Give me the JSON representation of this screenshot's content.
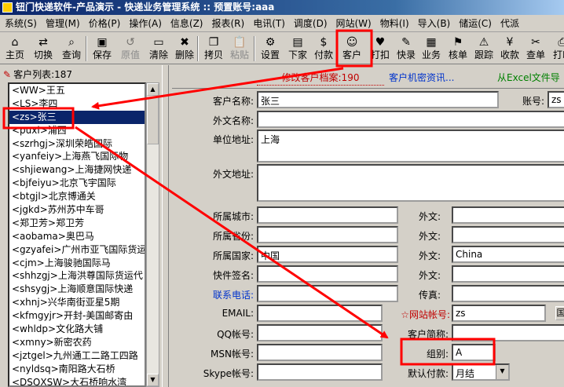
{
  "window": {
    "title": "钮门快递软件-产品演示 - 快递业务管理系统 :: 预置账号:aaa"
  },
  "menu": [
    "系统(S)",
    "管理(M)",
    "价格(P)",
    "操作(A)",
    "信息(Z)",
    "报表(R)",
    "电讯(T)",
    "调度(D)",
    "网站(W)",
    "物料(I)",
    "导入(B)",
    "储运(C)",
    "代派"
  ],
  "toolbar": [
    {
      "label": "主页",
      "icon": "home-icon",
      "glyph": "⌂",
      "disabled": false
    },
    {
      "label": "切换",
      "icon": "switch-icon",
      "glyph": "⇄",
      "disabled": false
    },
    {
      "label": "查询",
      "icon": "query-icon",
      "glyph": "⌕",
      "disabled": false
    },
    {
      "label": "保存",
      "icon": "save-icon",
      "glyph": "▣",
      "disabled": false
    },
    {
      "label": "原值",
      "icon": "original-value-icon",
      "glyph": "↺",
      "disabled": true
    },
    {
      "label": "清除",
      "icon": "clear-icon",
      "glyph": "▭",
      "disabled": false
    },
    {
      "label": "删除",
      "icon": "delete-icon",
      "glyph": "✖",
      "disabled": false
    },
    {
      "label": "拷贝",
      "icon": "copy-icon",
      "glyph": "❐",
      "disabled": false
    },
    {
      "label": "粘贴",
      "icon": "paste-icon",
      "glyph": "📋",
      "disabled": true
    },
    {
      "label": "设置",
      "icon": "settings-icon",
      "glyph": "⚙",
      "disabled": false
    },
    {
      "label": "下家",
      "icon": "next-agent-icon",
      "glyph": "▤",
      "disabled": false
    },
    {
      "label": "付款",
      "icon": "payment-icon",
      "glyph": "$",
      "disabled": false
    },
    {
      "label": "客户",
      "icon": "customer-icon",
      "glyph": "☺",
      "disabled": false
    },
    {
      "label": "打扣",
      "icon": "discount-icon",
      "glyph": "♥",
      "disabled": false
    },
    {
      "label": "快录",
      "icon": "quick-entry-icon",
      "glyph": "✎",
      "disabled": false
    },
    {
      "label": "业务",
      "icon": "business-icon",
      "glyph": "▦",
      "disabled": false
    },
    {
      "label": "核单",
      "icon": "verify-icon",
      "glyph": "⚑",
      "disabled": false
    },
    {
      "label": "跟踪",
      "icon": "track-icon",
      "glyph": "⚠",
      "disabled": false
    },
    {
      "label": "收款",
      "icon": "receive-icon",
      "glyph": "¥",
      "disabled": false
    },
    {
      "label": "查单",
      "icon": "search-order-icon",
      "glyph": "✂",
      "disabled": false
    },
    {
      "label": "打印",
      "icon": "print-icon",
      "glyph": "⎙",
      "disabled": false
    }
  ],
  "customer_list": {
    "header": "客户列表:187",
    "selected_index": 2,
    "items": [
      "<WW>王五",
      "<LS>李四",
      "<zs>张三",
      "<puxi>浦西",
      "<szrhgj>深圳荣皓国际",
      "<yanfeiy>上海燕飞国际物",
      "<shjiewang>上海捷网快递",
      "<bjfeiyu>北京飞宇国际",
      "<btgjl>北京博通关",
      "<jgkd>苏州苏中车哥",
      "<郑卫芳>郑卫芳",
      "<aobama>奥巴马",
      "<gzyafei>广州市亚飞国际货运",
      "<cjm>上海骏驰国际马",
      "<shhzgj>上海洪尊国际货运代",
      "<shsygj>上海顺意国际快递",
      "<xhnj>兴华南街亚星5期",
      "<kfmgyjr>开封-美国邮寄由",
      "<whldp>文化路大铺",
      "<xmny>新密农药",
      "<jztgel>九州通工二路工四路",
      "<nyldsq>南阳路大石桥",
      "<DSQXSW>大石桥响水湾"
    ]
  },
  "tabs": {
    "edit_archive": "修改客户档案:190",
    "secret_info": "客户机密资讯...",
    "excel_import": "从Excel文件导"
  },
  "form": {
    "customer_name": {
      "label": "客户名称:",
      "value": "张三"
    },
    "account_no": {
      "label": "账号:",
      "value": "zs"
    },
    "foreign_name": {
      "label": "外文名称:",
      "value": ""
    },
    "company_address": {
      "label": "单位地址:",
      "value": "上海"
    },
    "foreign_address": {
      "label": "外文地址:",
      "value": ""
    },
    "city": {
      "label": "所属城市:",
      "value": ""
    },
    "city_foreign": {
      "label": "外文:",
      "value": ""
    },
    "province": {
      "label": "所属省份:",
      "value": ""
    },
    "province_foreign": {
      "label": "外文:",
      "value": ""
    },
    "country": {
      "label": "所属国家:",
      "value": "中国"
    },
    "country_foreign": {
      "label": "外文:",
      "value": "China"
    },
    "signature": {
      "label": "快件签名:",
      "value": ""
    },
    "signature_foreign": {
      "label": "外文:",
      "value": ""
    },
    "phone": {
      "label": "联系电话:",
      "value": ""
    },
    "fax": {
      "label": "传真:",
      "value": ""
    },
    "email": {
      "label": "EMAIL:",
      "value": ""
    },
    "web_account": {
      "label": "☆网站帐号:",
      "value": "zs"
    },
    "qq": {
      "label": "QQ帐号:",
      "value": ""
    },
    "short_name": {
      "label": "客户简称:",
      "value": ""
    },
    "msn": {
      "label": "MSN帐号:",
      "value": ""
    },
    "group": {
      "label": "组别:",
      "value": "A"
    },
    "skype": {
      "label": "Skype帐号:",
      "value": ""
    },
    "default_payment": {
      "label": "默认付款:",
      "value": "月结"
    }
  },
  "colors": {
    "annotation": "#ff0000",
    "selection": "#0a246a",
    "title_bar": "#0a246a"
  }
}
